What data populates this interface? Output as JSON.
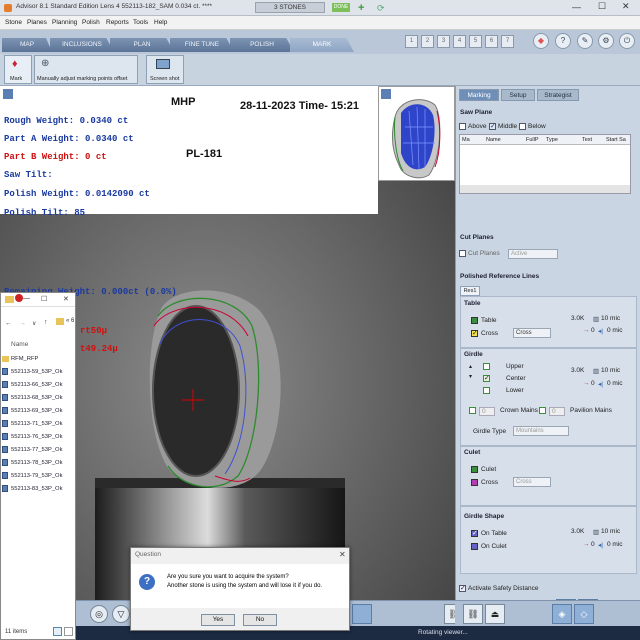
{
  "window": {
    "title": "Advisor 8.1 Standard Edition Lens 4   552113-182_SAM   0.034 ct. ****",
    "center_tag": "3 STONES",
    "done_badge": "DONE"
  },
  "menu": [
    "Stone",
    "Planes",
    "Planning",
    "Polish",
    "Reports",
    "Tools",
    "Help"
  ],
  "tabs": [
    "MAP",
    "INCLUSIONS",
    "PLAN",
    "FINE TUNE",
    "POLISH",
    "MARK"
  ],
  "active_tab": "MARK",
  "stone_numbers": [
    "1",
    "2",
    "3",
    "4",
    "5",
    "6",
    "7"
  ],
  "toolbar": {
    "mark_label": "Mark",
    "adjust_label": "Manually adjust marking points offset",
    "screenshot_label": "Screen shot"
  },
  "overlay": {
    "rough_weight": "Rough Weight: 0.0340 ct",
    "part_a": "Part A Weight: 0.0340 ct",
    "part_b": "Part B Weight: 0 ct",
    "saw_tilt": "Saw Tilt:",
    "polish_weight": "Polish Weight: 0.0142090 ct",
    "polish_tilt": "Polish Tilt: 85",
    "remaining": "Remaining Weight: 0.000ct (0.0%)",
    "mhp": "MHP",
    "date": "28-11-2023 Time- 15:21",
    "pl": "PL-181",
    "val1": "rt50μ",
    "val2": "t49.24μ"
  },
  "right_panel": {
    "tabs": [
      "Marking",
      "Setup",
      "Strategist"
    ],
    "saw_plane": {
      "title": "Saw Plane",
      "above": "Above",
      "middle": "Middle",
      "below": "Below",
      "columns": [
        "Ma",
        "Name",
        "FullP",
        "Type",
        "Text",
        "Start Sa"
      ]
    },
    "cut_planes": {
      "title": "Cut Planes",
      "checkbox": "Cut Planes",
      "select": "Active"
    },
    "polished_ref": "Polished Reference Lines",
    "res_tab": "Res1",
    "table": {
      "title": "Table",
      "table_label": "Table",
      "cross_label": "Cross",
      "cross_select": "Cross",
      "size_val": "3.0K",
      "size_unit": "10 mic",
      "offset_val": "0",
      "offset_unit": "0 mic"
    },
    "girdle": {
      "title": "Girdle",
      "upper": "Upper",
      "center": "Center",
      "lower": "Lower",
      "size_val": "3.0K",
      "size_unit": "10 mic",
      "offset_val": "0",
      "offset_unit": "0 mic",
      "crown_count": "0",
      "crown_label": "Crown Mains",
      "pav_count": "0",
      "pav_label": "Pavilion Mains",
      "type_label": "Girdle Type",
      "type_select": "Mountains"
    },
    "culet": {
      "title": "Culet",
      "culet_label": "Culet",
      "cross_label": "Cross",
      "cross_select": "Cross"
    },
    "girdle_shape": {
      "title": "Girdle Shape",
      "on_table": "On Table",
      "on_culet": "On Culet",
      "size_val": "3.0K",
      "size_unit": "10 mic",
      "offset_val": "0",
      "offset_unit": "0 mic"
    },
    "safety": "Activate Safety Distance"
  },
  "explorer": {
    "header": "Name",
    "path": "« 6",
    "folder": "RFM_RFP",
    "files": [
      "552113-59_53P_Ok",
      "552113-66_53P_Ok",
      "552113-68_53P_Ok",
      "552113-69_53P_Ok",
      "552113-71_53P_Ok",
      "552113-76_53P_Ok",
      "552113-77_53P_Ok",
      "552113-78_53P_Ok",
      "552113-79_53P_Ok",
      "552113-83_53P_Ok"
    ],
    "count": "11 items"
  },
  "dialog": {
    "title": "Question",
    "line1": "Are you sure you want to acquire the system?",
    "line2": "Another stone is using the system and will lose it if you do.",
    "yes": "Yes",
    "no": "No"
  },
  "status": "Rotating viewer..."
}
